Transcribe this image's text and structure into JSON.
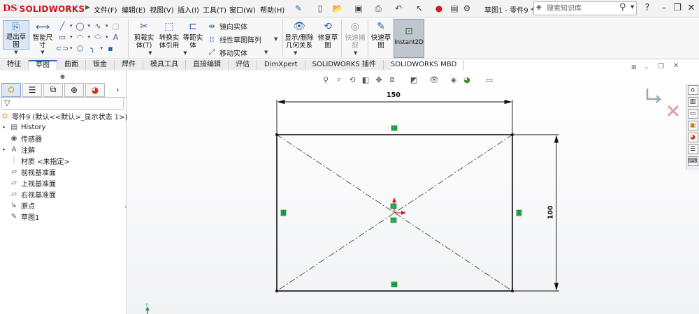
{
  "app": {
    "logo": "SOLIDWORKS",
    "logo_mark": "DS"
  },
  "menu": [
    "文件(F)",
    "编辑(E)",
    "视图(V)",
    "插入(I)",
    "工具(T)",
    "窗口(W)",
    "帮助(H)"
  ],
  "document_title": "草图1 - 零件9 *",
  "search": {
    "placeholder": "搜索知识库"
  },
  "ribbon": {
    "exit_sketch": "退出草\n图",
    "smart_dim": "智能尺\n寸",
    "trim": "剪裁实\n体(T)",
    "convert": "转换实\n体引用",
    "offset": "等距实\n体",
    "mirror": "镜向实体",
    "linear_pattern": "线性草图阵列",
    "move": "移动实体",
    "display_relations": "显示/删除\n几何关系",
    "repair": "修复草\n图",
    "quick_snaps": "快速捕\n捉",
    "rapid_sketch": "快速草\n图",
    "instant2d": "Instant2D"
  },
  "tabs": [
    "特征",
    "草图",
    "曲面",
    "钣金",
    "焊件",
    "模具工具",
    "直接编辑",
    "评估",
    "DimXpert",
    "SOLIDWORKS 插件",
    "SOLIDWORKS MBD"
  ],
  "active_tab": "草图",
  "tree": {
    "root": "零件9 (默认<<默认>_显示状态 1>)",
    "items": [
      "History",
      "传感器",
      "注解",
      "材质 <未指定>",
      "前视基准面",
      "上视基准面",
      "右视基准面",
      "原点",
      "草图1"
    ]
  },
  "sketch": {
    "dim_width": "150",
    "dim_height": "100"
  },
  "colors": {
    "accent": "#2b66b8",
    "brand": "#c8141e",
    "relation": "#22b14c"
  }
}
